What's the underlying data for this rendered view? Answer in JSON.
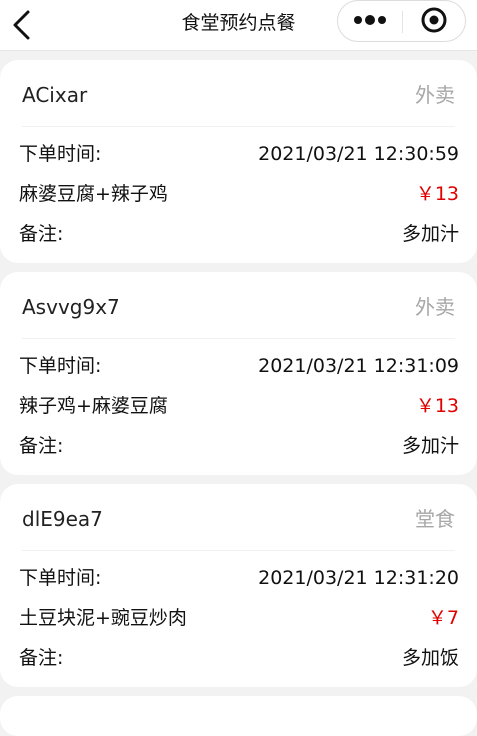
{
  "navbar": {
    "title": "食堂预约点餐"
  },
  "orders": [
    {
      "user": "ACixar",
      "type": "外卖",
      "time_label": "下单时间:",
      "time": "2021/03/21 12:30:59",
      "dishes": "麻婆豆腐+辣子鸡",
      "price": "￥13",
      "note_label": "备注:",
      "note": "多加汁"
    },
    {
      "user": "Asvvg9x7",
      "type": "外卖",
      "time_label": "下单时间:",
      "time": "2021/03/21 12:31:09",
      "dishes": "辣子鸡+麻婆豆腐",
      "price": "￥13",
      "note_label": "备注:",
      "note": "多加汁"
    },
    {
      "user": "dlE9ea7",
      "type": "堂食",
      "time_label": "下单时间:",
      "time": "2021/03/21 12:31:20",
      "dishes": "土豆块泥+豌豆炒肉",
      "price": "￥7",
      "note_label": "备注:",
      "note": "多加饭"
    }
  ],
  "colors": {
    "price": "#e10000",
    "type_label": "#a7a7a7",
    "background": "#f2f2f2",
    "card": "#ffffff"
  }
}
